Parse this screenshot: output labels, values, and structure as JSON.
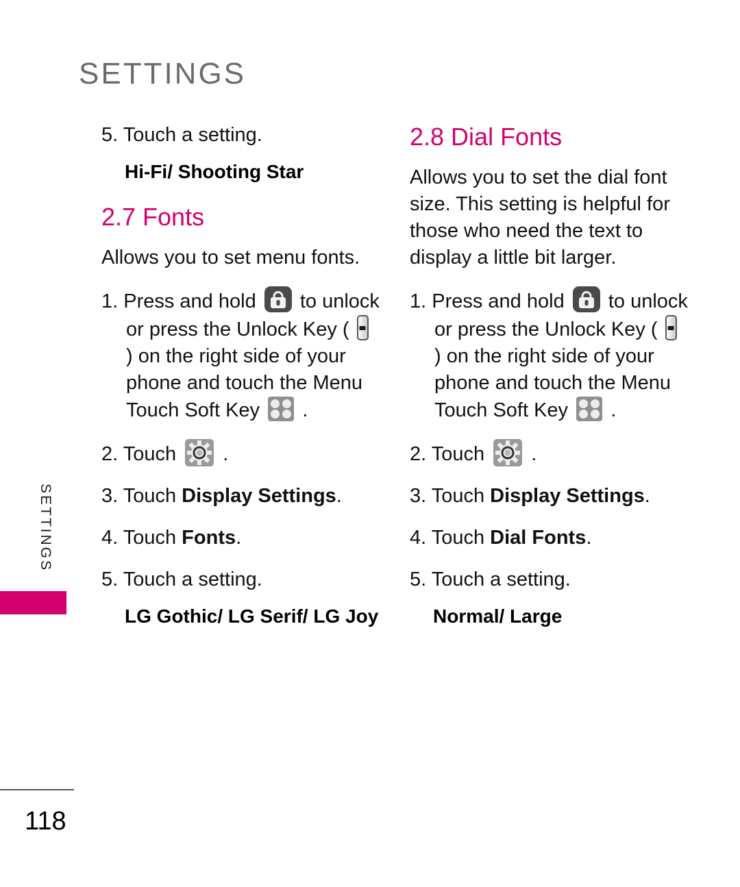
{
  "header": {
    "title": "SETTINGS"
  },
  "side_tab": {
    "label": "SETTINGS",
    "accent_color": "#d4006e"
  },
  "colors": {
    "accent": "#d4006e",
    "header_gray": "#6b6b6b",
    "body_text": "#111111"
  },
  "left_column": {
    "continued_step": "5. Touch a setting.",
    "continued_options": "Hi-Fi/ Shooting Star",
    "section": {
      "number": "2.7",
      "title": "Fonts",
      "heading": "2.7 Fonts",
      "intro": "Allows you to set menu fonts.",
      "steps": {
        "step1_prefix": "1. Press and hold",
        "step1_mid": "to unlock or press the Unlock Key (",
        "step1_after_key": ") on the right side of your phone and touch the Menu Touch Soft Key",
        "step1_end": ".",
        "step2_prefix": "2. Touch",
        "step2_end": ".",
        "step3_prefix": "3. Touch",
        "step3_bold": "Display Settings",
        "step3_end": ".",
        "step4_prefix": "4. Touch",
        "step4_bold": "Fonts",
        "step4_end": ".",
        "step5": "5. Touch a setting."
      },
      "options": "LG Gothic/ LG Serif/ LG Joy"
    }
  },
  "right_column": {
    "section": {
      "number": "2.8",
      "title": "Dial Fonts",
      "heading": "2.8 Dial Fonts",
      "intro": "Allows you to set the dial font size. This setting is helpful for those who need the text to display a little bit larger.",
      "steps": {
        "step1_prefix": "1. Press and hold",
        "step1_mid": "to unlock or press the Unlock Key (",
        "step1_after_key": ") on the right side of your phone and touch the Menu Touch Soft Key",
        "step1_end": ".",
        "step2_prefix": "2. Touch",
        "step2_end": ".",
        "step3_prefix": "3. Touch",
        "step3_bold": "Display Settings",
        "step3_end": ".",
        "step4_prefix": "4. Touch",
        "step4_bold": "Dial Fonts",
        "step4_end": ".",
        "step5": "5. Touch a setting."
      },
      "options": "Normal/ Large"
    }
  },
  "icons": {
    "lock": "lock-icon",
    "unlock_key": "unlock-key-icon",
    "soft_key": "menu-touch-soft-key-icon",
    "gear": "settings-gear-icon"
  },
  "footer": {
    "page_number": "118"
  }
}
